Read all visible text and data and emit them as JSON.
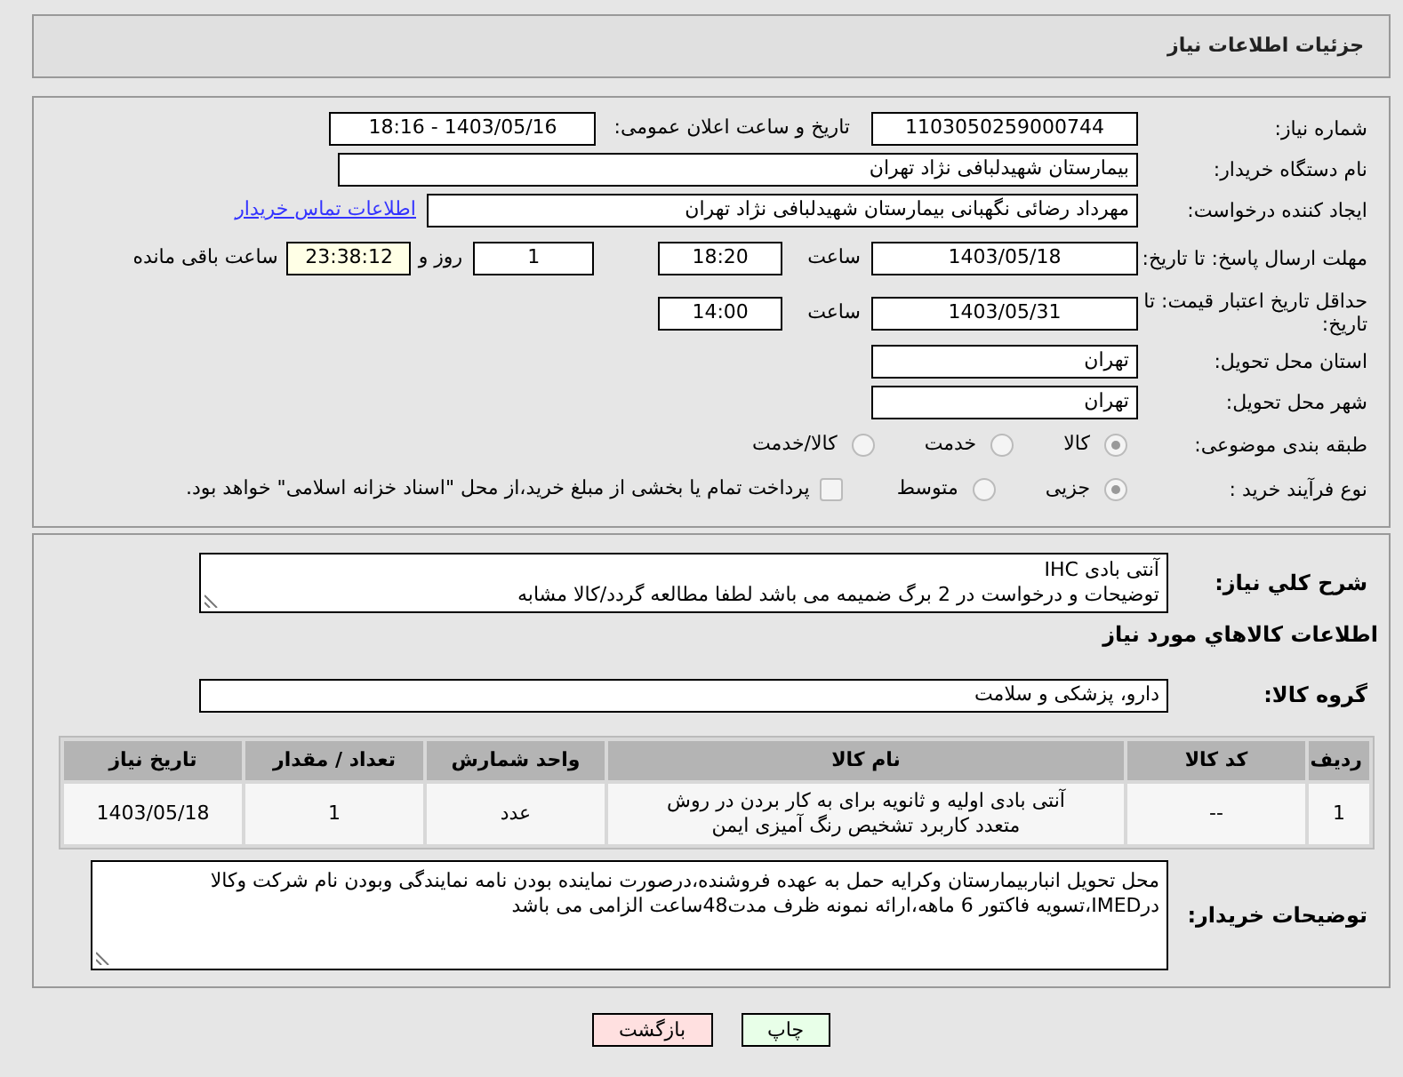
{
  "header": {
    "title": "جزئیات اطلاعات نیاز"
  },
  "need_number": {
    "label": "شماره نیاز:",
    "value": "1103050259000744"
  },
  "announce": {
    "label": "تاریخ و ساعت اعلان عمومی:",
    "value": "1403/05/16 - 18:16"
  },
  "buyer_org": {
    "label": "نام دستگاه خریدار:",
    "value": "بیمارستان شهیدلبافی نژاد تهران"
  },
  "requester": {
    "label": "ایجاد کننده درخواست:",
    "value": "مهرداد رضائی نگهبانی بیمارستان شهیدلبافی نژاد تهران",
    "link": "اطلاعات تماس خریدار"
  },
  "reply_deadline": {
    "label": "مهلت ارسال پاسخ: تا تاریخ:",
    "date": "1403/05/18",
    "time_label": "ساعت",
    "time": "18:20",
    "days": "1",
    "days_label": "روز و",
    "remaining": "23:38:12",
    "remaining_label": "ساعت باقی مانده"
  },
  "price_validity": {
    "label": "حداقل تاریخ اعتبار قیمت: تا تاریخ:",
    "date": "1403/05/31",
    "time_label": "ساعت",
    "time": "14:00"
  },
  "province": {
    "label": "استان محل تحویل:",
    "value": "تهران"
  },
  "city": {
    "label": "شهر محل تحویل:",
    "value": "تهران"
  },
  "category": {
    "label": "طبقه بندی موضوعی:",
    "options": [
      {
        "label": "کالا",
        "selected": true
      },
      {
        "label": "خدمت",
        "selected": false
      },
      {
        "label": "کالا/خدمت",
        "selected": false
      }
    ]
  },
  "process": {
    "label": "نوع فرآیند خرید :",
    "options": [
      {
        "label": "جزیی",
        "selected": true
      },
      {
        "label": "متوسط",
        "selected": false
      }
    ],
    "payment": {
      "label": "پرداخت تمام یا بخشی از مبلغ خرید،از محل \"اسناد خزانه اسلامی\" خواهد بود.",
      "checked": false
    }
  },
  "description": {
    "label": "شرح کلي نیاز:",
    "lines": [
      "آنتی بادی IHC",
      "توضیحات و درخواست در 2 برگ ضمیمه می باشد لطفا مطالعه گردد/کالا مشابه"
    ]
  },
  "goods_heading": "اطلاعات کالاهاي مورد نیاز",
  "goods_group": {
    "label": "گروه کالا:",
    "value": "دارو، پزشکی و سلامت"
  },
  "table": {
    "columns": [
      "ردیف",
      "کد کالا",
      "نام کالا",
      "واحد شمارش",
      "تعداد / مقدار",
      "تاریخ نیاز"
    ],
    "rows": [
      [
        "1",
        "--",
        "آنتی بادی اولیه و ثانویه برای به کار بردن در روش متعدد کاربرد تشخیص رنگ آمیزی ایمن",
        "عدد",
        "1",
        "1403/05/18"
      ]
    ]
  },
  "buyer_notes": {
    "label": "توضیحات خریدار:",
    "text": "محل تحویل انباربیمارستان وکرایه حمل به عهده فروشنده،درصورت نماینده بودن نامه نمایندگی وبودن نام شرکت وکالا درIMED،تسویه فاکتور 6 ماهه،ارائه نمونه ظرف مدت48ساعت الزامی می باشد"
  },
  "buttons": [
    {
      "label": "چاپ",
      "kind": "print"
    },
    {
      "label": "بازگشت",
      "kind": "back"
    }
  ]
}
